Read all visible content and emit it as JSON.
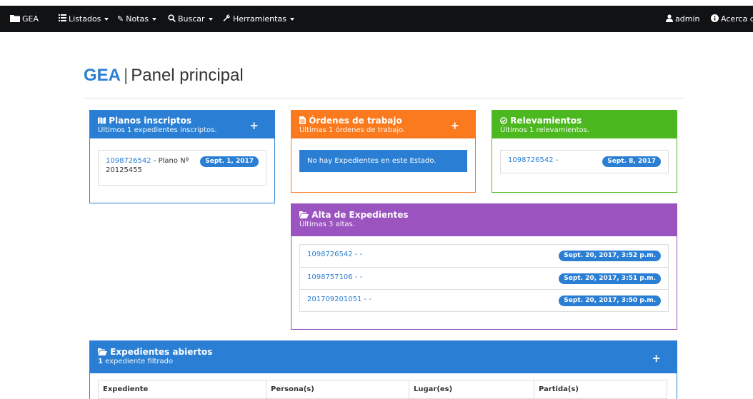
{
  "navbar": {
    "brand": "GEA",
    "listados": "Listados",
    "notas": "Notas",
    "buscar": "Buscar",
    "herramientas": "Herramientas",
    "user": "admin",
    "about": "Acerca de"
  },
  "page": {
    "brand": "GEA",
    "separator": "|",
    "title": "Panel principal"
  },
  "planos": {
    "title": "Planos inscriptos",
    "subtitle": "Últimos 1 expedientes inscriptos.",
    "plus": "+",
    "items": [
      {
        "link": "1098726542",
        "text": " - Plano Nº 20125455",
        "date": "Sept. 1, 2017"
      }
    ]
  },
  "ordenes": {
    "title": "Órdenes de trabajo",
    "subtitle": "Últimas 1 órdenes de trabajo.",
    "plus": "+",
    "empty_message": "No hay Expedientes en este Estado."
  },
  "relevamientos": {
    "title": "Relevamientos",
    "subtitle": "Últimos 1 relevamientos.",
    "items": [
      {
        "link": "1098726542 -",
        "date": "Sept. 8, 2017"
      }
    ]
  },
  "alta": {
    "title": "Alta de Expedientes",
    "subtitle": "Últimas 3 altas.",
    "items": [
      {
        "link": "1098726542 - -",
        "date": "Sept. 20, 2017, 3:52 p.m."
      },
      {
        "link": "1098757106 - -",
        "date": "Sept. 20, 2017, 3:51 p.m."
      },
      {
        "link": "201709201051 - -",
        "date": "Sept. 20, 2017, 3:50 p.m."
      }
    ]
  },
  "abiertos": {
    "title": "Expedientes abiertos",
    "count": "1",
    "subtitle_rest": " expediente filtrado",
    "plus": "+",
    "columns": [
      "Expediente",
      "Persona(s)",
      "Lugar(es)",
      "Partida(s)"
    ]
  },
  "colors": {
    "blue": "#2a7fd4",
    "orange": "#fb7a1d",
    "green": "#4cb81f",
    "purple": "#9a53bf",
    "navbar": "#111214"
  }
}
